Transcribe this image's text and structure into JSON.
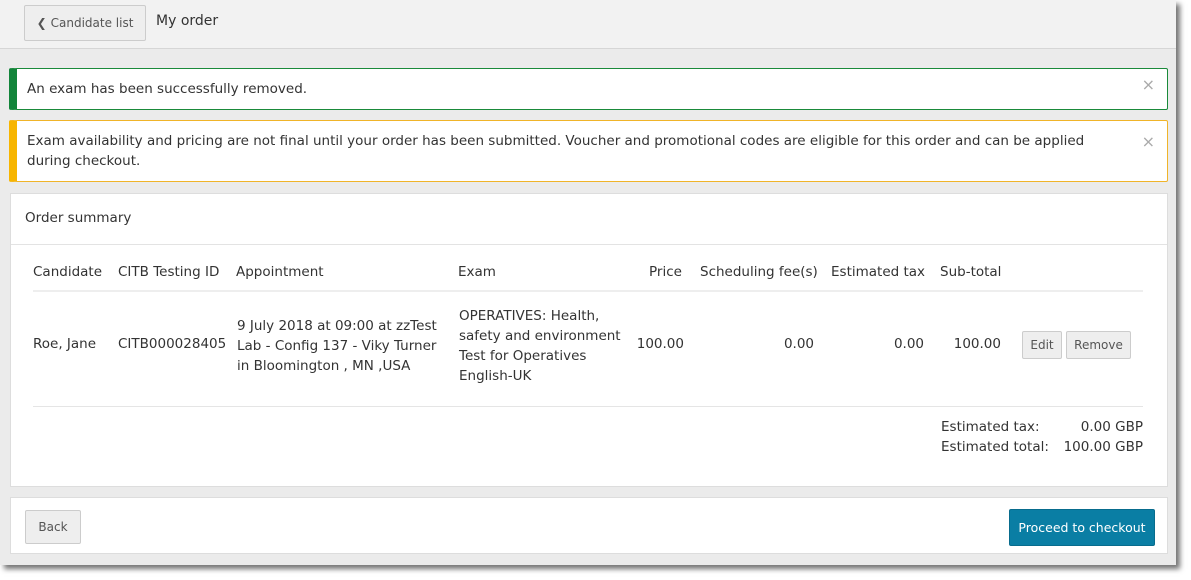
{
  "header": {
    "back_button_label": "Candidate list",
    "back_icon": "chevron-left-icon",
    "page_title": "My order"
  },
  "alerts": {
    "success": {
      "message": "An exam has been successfully removed.",
      "close_glyph": "×",
      "color": "#12843a"
    },
    "warning": {
      "message": "Exam availability and pricing are not final until your order has been submitted. Voucher and promotional codes are eligible for this order and can be applied during checkout.",
      "close_glyph": "×",
      "color": "#f7b500"
    }
  },
  "order_summary": {
    "title": "Order summary",
    "columns": [
      "Candidate",
      "CITB Testing ID",
      "Appointment",
      "Exam",
      "Price",
      "Scheduling fee(s)",
      "Estimated tax",
      "Sub-total"
    ],
    "rows": [
      {
        "candidate": "Roe, Jane",
        "testing_id": "CITB000028405",
        "appointment": "9 July 2018 at 09:00 at zzTest Lab - Config 137 - Viky Turner in Bloomington , MN ,USA",
        "exam": "OPERATIVES: Health, safety and environment Test for Operatives English-UK",
        "price": "100.00",
        "scheduling_fee": "0.00",
        "estimated_tax": "0.00",
        "subtotal": "100.00",
        "edit_label": "Edit",
        "remove_label": "Remove"
      }
    ],
    "totals": {
      "tax_label": "Estimated tax:",
      "tax_value": "0.00 GBP",
      "total_label": "Estimated total:",
      "total_value": "100.00 GBP"
    }
  },
  "footer": {
    "back_label": "Back",
    "checkout_label": "Proceed to checkout",
    "checkout_color": "#0a7ea4"
  }
}
